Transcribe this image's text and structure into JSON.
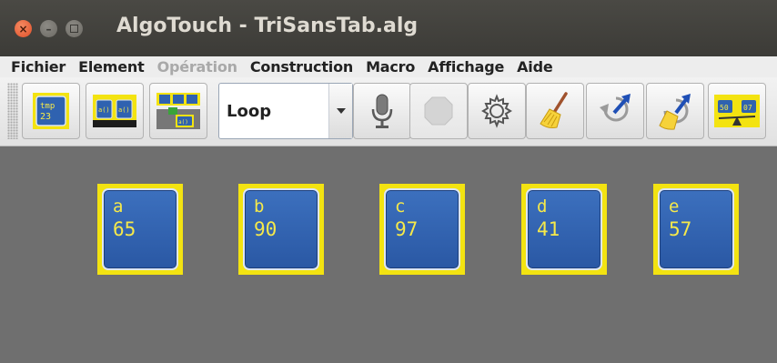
{
  "window": {
    "title": "AlgoTouch - TriSansTab.alg"
  },
  "menu": {
    "items": [
      {
        "label": "Fichier",
        "enabled": true
      },
      {
        "label": "Element",
        "enabled": true
      },
      {
        "label": "Opération",
        "enabled": false
      },
      {
        "label": "Construction",
        "enabled": true
      },
      {
        "label": "Macro",
        "enabled": true
      },
      {
        "label": "Affichage",
        "enabled": true
      },
      {
        "label": "Aide",
        "enabled": true
      }
    ]
  },
  "toolbar": {
    "buttons": [
      {
        "icon": "tmp-variable-icon",
        "icon_text_top": "tmp",
        "icon_text_bottom": "23",
        "enabled": true
      },
      {
        "icon": "array-variables-icon",
        "enabled": true
      },
      {
        "icon": "indexed-array-icon",
        "enabled": true
      },
      {
        "icon": "microphone-icon",
        "enabled": true
      },
      {
        "icon": "stop-icon",
        "enabled": false
      },
      {
        "icon": "gear-icon",
        "enabled": true
      },
      {
        "icon": "broom-icon",
        "enabled": true
      },
      {
        "icon": "undo-icon",
        "enabled": true
      },
      {
        "icon": "broom-undo-icon",
        "enabled": true
      },
      {
        "icon": "balance-compare-icon",
        "icon_text_left": "50",
        "icon_text_right": "07",
        "enabled": true
      }
    ],
    "mode_select": {
      "value": "Loop"
    }
  },
  "canvas": {
    "variables": [
      {
        "name": "a",
        "value": "65"
      },
      {
        "name": "b",
        "value": "90"
      },
      {
        "name": "c",
        "value": "97"
      },
      {
        "name": "d",
        "value": "41"
      },
      {
        "name": "e",
        "value": "57"
      }
    ]
  },
  "colors": {
    "canvas_background": "#6f6f6f",
    "variable_frame": "#f3e311",
    "variable_box": "#2f62b0",
    "variable_text": "#f6e94a"
  }
}
